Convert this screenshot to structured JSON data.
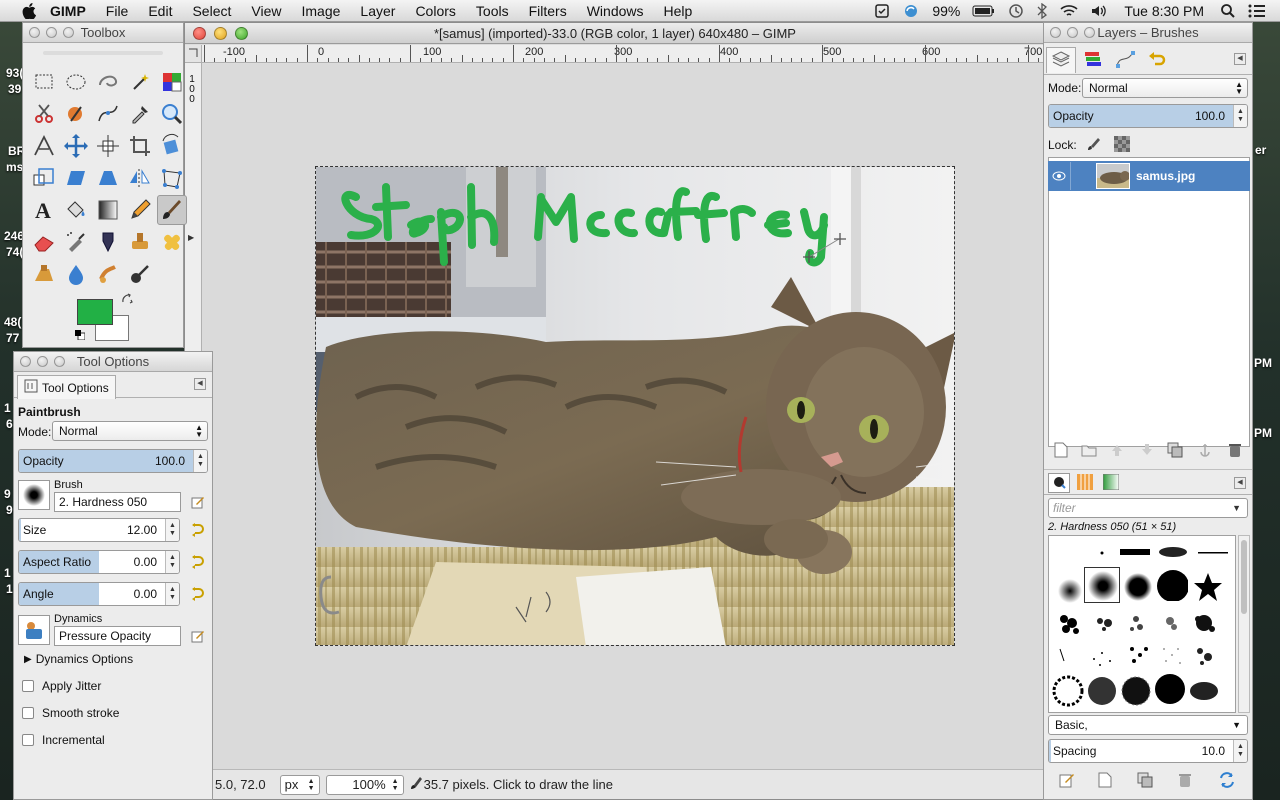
{
  "menubar": {
    "app": "GIMP",
    "items": [
      "File",
      "Edit",
      "Select",
      "View",
      "Image",
      "Layer",
      "Colors",
      "Tools",
      "Filters",
      "Windows",
      "Help"
    ],
    "battery": "99%",
    "clock": "Tue 8:30 PM"
  },
  "desktop": {
    "fragments": [
      "93(",
      "39",
      "BR",
      "ms",
      "246",
      "74(",
      "48(",
      "77",
      "1",
      "6",
      "9",
      "9",
      "1",
      "1"
    ],
    "right_fragments": [
      "er",
      "PM",
      "PM"
    ]
  },
  "image_window": {
    "title": "*[samus] (imported)-33.0 (RGB color, 1 layer) 640x480 – GIMP",
    "ruler_labels": [
      "-100",
      "0",
      "100",
      "200",
      "300",
      "400",
      "500",
      "600",
      "700"
    ],
    "vruler_label": "100",
    "handwriting": "Steph McCaffrey",
    "status": {
      "coords": "5.0, 72.0",
      "unit": "px",
      "zoom": "100%",
      "message": "35.7 pixels.  Click to draw the line"
    }
  },
  "toolbox": {
    "title": "Toolbox",
    "tools": [
      "rect-select",
      "ellipse-select",
      "free-select",
      "fuzzy-select",
      "select-by-color",
      "scissors-select",
      "foreground-select",
      "paths",
      "color-picker",
      "zoom",
      "measure",
      "move",
      "align",
      "crop",
      "rotate",
      "scale",
      "shear",
      "perspective",
      "flip",
      "cage",
      "text",
      "bucket-fill",
      "blend",
      "pencil",
      "paintbrush",
      "eraser",
      "airbrush",
      "ink",
      "clone",
      "heal",
      "perspective-clone",
      "blur",
      "smudge",
      "dodge-burn"
    ],
    "active_tool": "paintbrush",
    "fg_color": "#22b045",
    "bg_color": "#ffffff"
  },
  "tool_options": {
    "title": "Tool Options",
    "tab": "Tool Options",
    "tool_name": "Paintbrush",
    "mode_label": "Mode:",
    "mode": "Normal",
    "opacity_label": "Opacity",
    "opacity": "100.0",
    "opacity_level": 1.0,
    "brush_label": "Brush",
    "brush": "2. Hardness 050",
    "size_label": "Size",
    "size": "12.00",
    "size_level": 0.01,
    "aspect_label": "Aspect Ratio",
    "aspect": "0.00",
    "aspect_level": 0.5,
    "angle_label": "Angle",
    "angle": "0.00",
    "angle_level": 0.5,
    "dynamics_label": "Dynamics",
    "dynamics": "Pressure Opacity",
    "dynamics_options": "Dynamics Options",
    "checkboxes": [
      "Apply Jitter",
      "Smooth stroke",
      "Incremental"
    ]
  },
  "layers_panel": {
    "title": "Layers – Brushes",
    "mode_label": "Mode:",
    "mode": "Normal",
    "opacity_label": "Opacity",
    "opacity": "100.0",
    "lock_label": "Lock:",
    "layer_name": "samus.jpg",
    "filter_placeholder": "filter",
    "brush_info": "2. Hardness 050 (51 × 51)",
    "tag": "Basic,",
    "spacing_label": "Spacing",
    "spacing": "10.0"
  },
  "colors": {
    "accent": "#4d82c1",
    "paint": "#22b045",
    "slider_fill": "#b8cfe6"
  }
}
